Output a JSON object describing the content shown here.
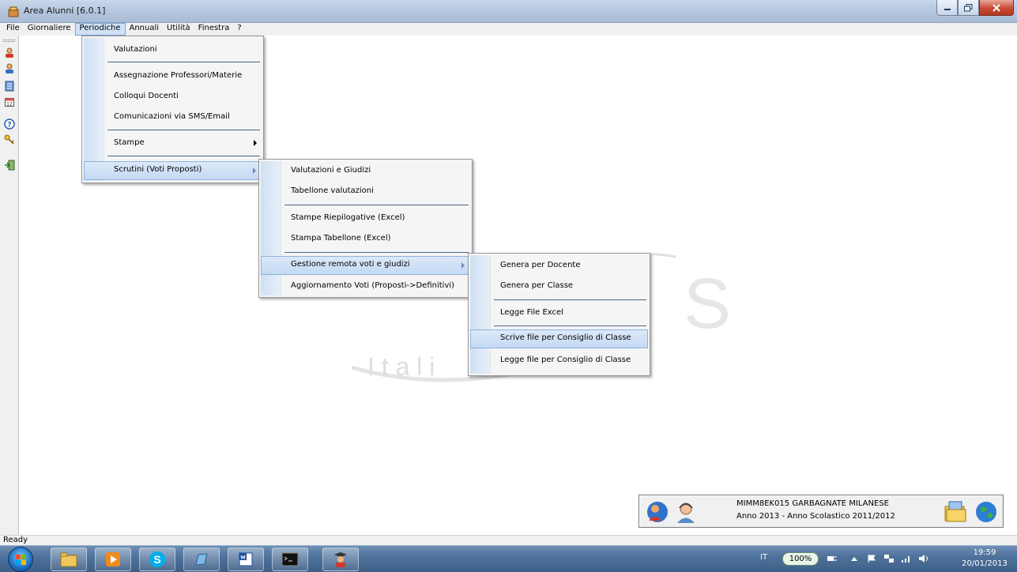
{
  "window": {
    "title": "Area Alunni [6.0.1]"
  },
  "menubar": {
    "items": [
      "File",
      "Giornaliere",
      "Periodiche",
      "Annuali",
      "Utilità",
      "Finestra",
      "?"
    ]
  },
  "menu_periodiche": {
    "items": [
      "Valutazioni",
      "Assegnazione Professori/Materie",
      "Colloqui Docenti",
      "Comunicazioni via SMS/Email",
      "Stampe",
      "Scrutini (Voti Proposti)"
    ]
  },
  "menu_scrutini": {
    "items": [
      "Valutazioni e Giudizi",
      "Tabellone valutazioni",
      "Stampe Riepilogative (Excel)",
      "Stampa Tabellone (Excel)",
      "Gestione remota voti e giudizi",
      "Aggiornamento Voti (Proposti->Definitivi)"
    ]
  },
  "menu_gestione_remota": {
    "items": [
      "Genera per Docente",
      "Genera per Classe",
      "Legge File Excel",
      "Scrive file per Consiglio di Classe",
      "Legge file per Consiglio di Classe"
    ]
  },
  "watermark": {
    "text": "I t a l i"
  },
  "info_panel": {
    "line1": "MIMM8EK015  GARBAGNATE MILANESE",
    "line2": "Anno 2013  -  Anno Scolastico 2011/2012"
  },
  "statusbar": {
    "text": "Ready"
  },
  "taskbar": {
    "language": "IT",
    "battery": "100%",
    "time": "19:59",
    "date": "20/01/2013"
  },
  "colors": {
    "menu_highlight": "#c3d9f4",
    "menu_gutter": "#cfe0f3",
    "taskbar": "#4f729c",
    "close_button": "#c84a35"
  }
}
